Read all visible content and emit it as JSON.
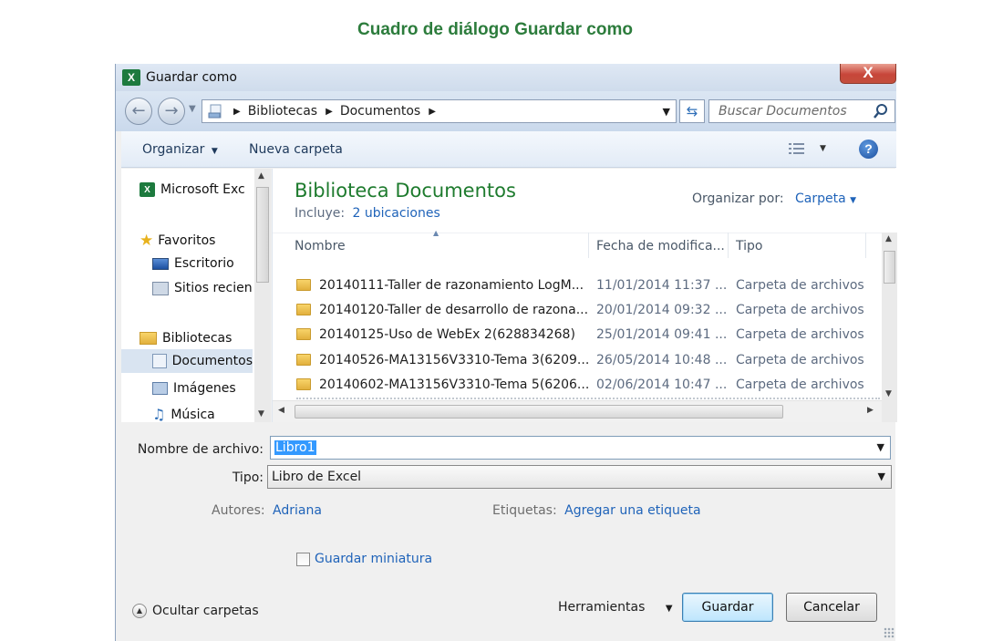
{
  "caption": "Cuadro de diálogo Guardar como",
  "dialog": {
    "title": "Guardar como",
    "close_glyph": "X",
    "breadcrumb": [
      "Bibliotecas",
      "Documentos"
    ],
    "search_placeholder": "Buscar Documentos",
    "toolbar": {
      "organize": "Organizar",
      "new_folder": "Nueva carpeta"
    },
    "nav": {
      "excel": "Microsoft Exc",
      "favorites": "Favoritos",
      "desktop": "Escritorio",
      "recent": "Sitios recien",
      "libraries": "Bibliotecas",
      "documents": "Documentos",
      "images": "Imágenes",
      "music": "Música"
    },
    "library": {
      "title": "Biblioteca Documentos",
      "includes_label": "Incluye:",
      "locations": "2 ubicaciones",
      "arrange_label": "Organizar por:",
      "arrange_value": "Carpeta"
    },
    "columns": {
      "name": "Nombre",
      "date": "Fecha de modifica...",
      "type": "Tipo"
    },
    "files": [
      {
        "name": "20140111-Taller de razonamiento LogM...",
        "date": "11/01/2014 11:37 ...",
        "type": "Carpeta de archivos"
      },
      {
        "name": "20140120-Taller de desarrollo de razona...",
        "date": "20/01/2014 09:32 ...",
        "type": "Carpeta de archivos"
      },
      {
        "name": "20140125-Uso de WebEx 2(628834268)",
        "date": "25/01/2014 09:41 ...",
        "type": "Carpeta de archivos"
      },
      {
        "name": "20140526-MA13156V3310-Tema 3(6209...",
        "date": "26/05/2014 10:48 ...",
        "type": "Carpeta de archivos"
      },
      {
        "name": "20140602-MA13156V3310-Tema 5(6206...",
        "date": "02/06/2014 10:47 ...",
        "type": "Carpeta de archivos"
      }
    ],
    "form": {
      "filename_label": "Nombre de archivo:",
      "filename_value": "Libro1",
      "type_label": "Tipo:",
      "type_value": "Libro de Excel",
      "authors_label": "Autores:",
      "authors_value": "Adriana",
      "tags_label": "Etiquetas:",
      "tags_value": "Agregar una etiqueta",
      "thumbnail_label": "Guardar miniatura"
    },
    "footer": {
      "hide_folders": "Ocultar carpetas",
      "tools": "Herramientas",
      "save": "Guardar",
      "cancel": "Cancelar"
    }
  }
}
